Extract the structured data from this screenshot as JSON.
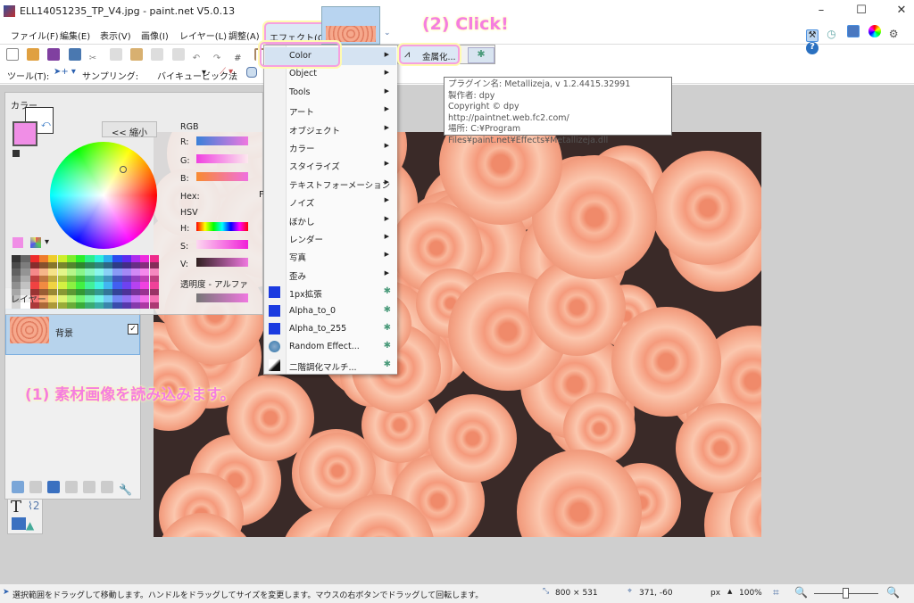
{
  "window": {
    "title": "ELL14051235_TP_V4.jpg - paint.net V5.0.13",
    "minimize": "–",
    "maximize": "☐",
    "close": "✕"
  },
  "menubar": [
    "ファイル(F)",
    "編集(E)",
    "表示(V)",
    "画像(I)",
    "レイヤー(L)",
    "調整(A)",
    "エフェクト(C)"
  ],
  "toolbar2": {
    "tool_label": "ツール(T):",
    "sampling_label": "サンプリング:",
    "sampling_value": "バイキュービック法"
  },
  "effects_menu": [
    {
      "label": "Color",
      "submenu": true
    },
    {
      "label": "Object",
      "submenu": true
    },
    {
      "label": "Tools",
      "submenu": true
    },
    {
      "label": "アート",
      "submenu": true
    },
    {
      "label": "オブジェクト",
      "submenu": true
    },
    {
      "label": "カラー",
      "submenu": true
    },
    {
      "label": "スタイライズ",
      "submenu": true
    },
    {
      "label": "テキストフォーメーション",
      "submenu": true
    },
    {
      "label": "ノイズ",
      "submenu": true
    },
    {
      "label": "ぼかし",
      "submenu": true
    },
    {
      "label": "レンダー",
      "submenu": true
    },
    {
      "label": "写真",
      "submenu": true
    },
    {
      "label": "歪み",
      "submenu": true
    },
    {
      "label": "1px拡張",
      "plugin": true
    },
    {
      "label": "Alpha_to_0",
      "plugin": true
    },
    {
      "label": "Alpha_to_255",
      "plugin": true
    },
    {
      "label": "Random Effect...",
      "plugin": true
    },
    {
      "label": "二階調化マルチ...",
      "plugin": true
    }
  ],
  "submenu": {
    "item": "金属化..."
  },
  "tooltip": [
    "プラグイン名: Metallizeja, v 1.2.4415.32991",
    "製作者: dpy",
    "Copyright © dpy",
    "http://paintnet.web.fc2.com/",
    "場所: C:¥Program Files¥paint.net¥Effects¥Metallizeja.dll"
  ],
  "colors_panel": {
    "title": "カラー",
    "shrink_button": "<< 縮小",
    "rgb": "RGB",
    "r": "R:",
    "g": "G:",
    "b": "B:",
    "hex": "Hex:",
    "hex_value": "F",
    "hsv": "HSV",
    "h": "H:",
    "s": "S:",
    "v": "V:",
    "alpha": "透明度 - アルファ",
    "primary_color": "#f08ee6"
  },
  "layers_panel": {
    "title": "レイヤー",
    "layer_name": "背景",
    "visible": true
  },
  "annotations": {
    "step1": "(1) 素材画像を読み込みます。",
    "step2": "(2) Click!"
  },
  "statusbar": {
    "hint": "選択範囲をドラッグして移動します。ハンドルをドラッグしてサイズを変更します。マウスの右ボタンでドラッグして回転します。",
    "image_size": "800 × 531",
    "cursor": "371, -60",
    "unit": "px",
    "zoom": "100%"
  }
}
